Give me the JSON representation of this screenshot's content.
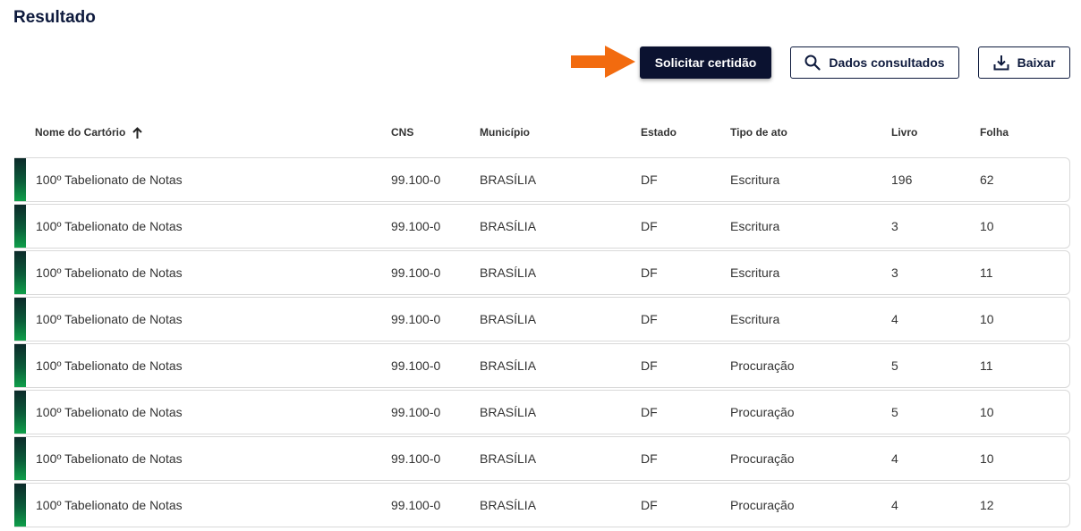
{
  "page": {
    "title": "Resultado"
  },
  "toolbar": {
    "solicitar_label": "Solicitar certidão",
    "dados_label": "Dados consultados",
    "baixar_label": "Baixar"
  },
  "colors": {
    "primary": "#0b1230",
    "arrow": "#f26b0f",
    "row_bar_top": "#0c2a2a",
    "row_bar_bottom": "#0fa04a"
  },
  "table": {
    "headers": {
      "nome": "Nome do Cartório",
      "cns": "CNS",
      "municipio": "Município",
      "estado": "Estado",
      "tipo": "Tipo de ato",
      "livro": "Livro",
      "folha": "Folha"
    },
    "sort_icon": "arrow-up-icon",
    "rows": [
      {
        "nome": "100º Tabelionato de Notas",
        "cns": "99.100-0",
        "municipio": "BRASÍLIA",
        "estado": "DF",
        "tipo": "Escritura",
        "livro": "196",
        "folha": "62"
      },
      {
        "nome": "100º Tabelionato de Notas",
        "cns": "99.100-0",
        "municipio": "BRASÍLIA",
        "estado": "DF",
        "tipo": "Escritura",
        "livro": "3",
        "folha": "10"
      },
      {
        "nome": "100º Tabelionato de Notas",
        "cns": "99.100-0",
        "municipio": "BRASÍLIA",
        "estado": "DF",
        "tipo": "Escritura",
        "livro": "3",
        "folha": "11"
      },
      {
        "nome": "100º Tabelionato de Notas",
        "cns": "99.100-0",
        "municipio": "BRASÍLIA",
        "estado": "DF",
        "tipo": "Escritura",
        "livro": "4",
        "folha": "10"
      },
      {
        "nome": "100º Tabelionato de Notas",
        "cns": "99.100-0",
        "municipio": "BRASÍLIA",
        "estado": "DF",
        "tipo": "Procuração",
        "livro": "5",
        "folha": "11"
      },
      {
        "nome": "100º Tabelionato de Notas",
        "cns": "99.100-0",
        "municipio": "BRASÍLIA",
        "estado": "DF",
        "tipo": "Procuração",
        "livro": "5",
        "folha": "10"
      },
      {
        "nome": "100º Tabelionato de Notas",
        "cns": "99.100-0",
        "municipio": "BRASÍLIA",
        "estado": "DF",
        "tipo": "Procuração",
        "livro": "4",
        "folha": "10"
      },
      {
        "nome": "100º Tabelionato de Notas",
        "cns": "99.100-0",
        "municipio": "BRASÍLIA",
        "estado": "DF",
        "tipo": "Procuração",
        "livro": "4",
        "folha": "12"
      }
    ]
  }
}
